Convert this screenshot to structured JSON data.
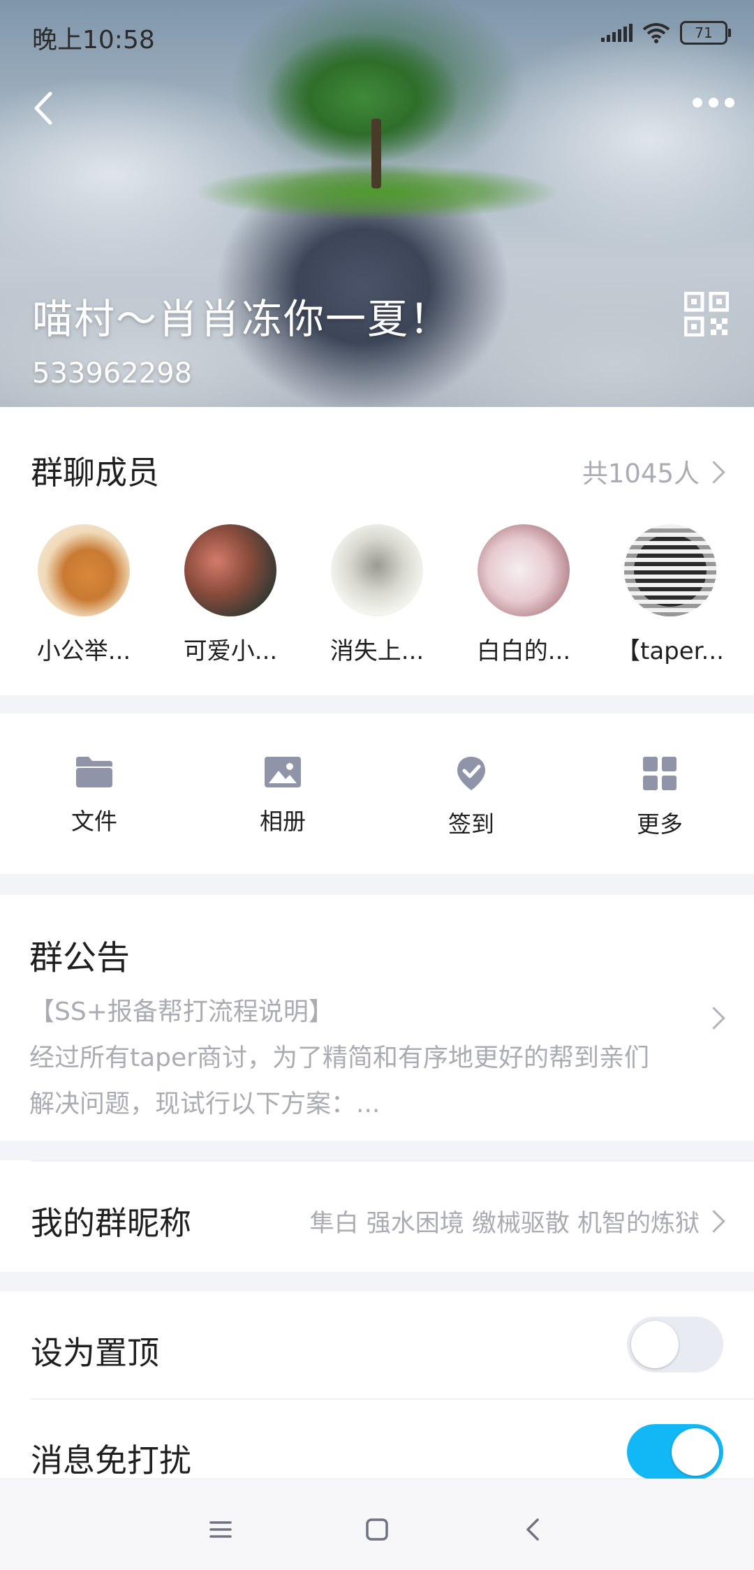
{
  "status_bar": {
    "time": "晚上10:58",
    "battery": "71",
    "icons": [
      "signal-icon",
      "wifi-icon",
      "battery-icon"
    ]
  },
  "header": {
    "group_name": "喵村～肖肖冻你一夏！",
    "group_id": "533962298",
    "back_icon": "back-icon",
    "more_icon": "more-icon",
    "qr_icon": "qr-code-icon"
  },
  "members": {
    "title": "群聊成员",
    "count": "共1045人",
    "items": [
      {
        "name": "小公举..."
      },
      {
        "name": "可爱小..."
      },
      {
        "name": "消失上..."
      },
      {
        "name": "白白的..."
      },
      {
        "name": "【taper..."
      }
    ]
  },
  "tools": [
    {
      "label": "文件",
      "icon": "folder-icon"
    },
    {
      "label": "相册",
      "icon": "image-icon"
    },
    {
      "label": "签到",
      "icon": "check-in-icon"
    },
    {
      "label": "更多",
      "icon": "grid-icon"
    }
  ],
  "notice": {
    "title": "群公告",
    "lines": [
      "【SS+报备帮打流程说明】",
      "经过所有taper商讨，为了精简和有序地更好的帮到亲们",
      "解决问题，现试行以下方案：..."
    ]
  },
  "nickname": {
    "label": "我的群昵称",
    "value": "隼白 强水困境 缴械驱散 机智的炼狱"
  },
  "settings": [
    {
      "label": "设为置顶",
      "on": false
    },
    {
      "label": "消息免打扰",
      "on": true
    }
  ],
  "colors": {
    "accent": "#12b7f5",
    "icon_gray": "#8f94a8",
    "muted_text": "#a9acb3"
  }
}
